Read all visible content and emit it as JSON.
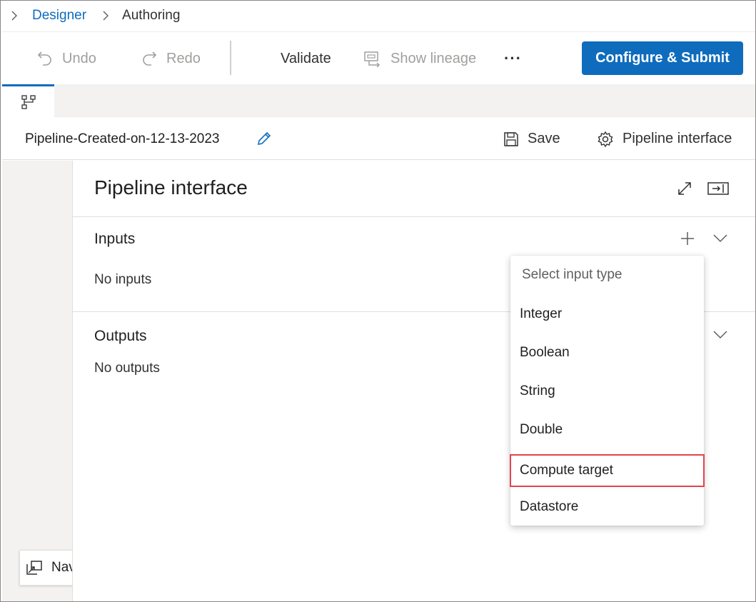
{
  "breadcrumb": {
    "items": [
      "Designer",
      "Authoring"
    ]
  },
  "toolbar": {
    "undo_label": "Undo",
    "redo_label": "Redo",
    "validate_label": "Validate",
    "show_lineage_label": "Show lineage",
    "more_label": "···",
    "configure_submit_label": "Configure & Submit"
  },
  "pipeline": {
    "name": "Pipeline-Created-on-12-13-2023",
    "save_label": "Save",
    "interface_label": "Pipeline interface"
  },
  "panel": {
    "title": "Pipeline interface",
    "inputs_title": "Inputs",
    "inputs_empty": "No inputs",
    "outputs_title": "Outputs",
    "outputs_empty": "No outputs"
  },
  "dropdown": {
    "header": "Select input type",
    "items": [
      "Integer",
      "Boolean",
      "String",
      "Double",
      "Compute target",
      "Datastore"
    ],
    "highlighted": "Compute target"
  },
  "navigator": {
    "label": "Navigator"
  },
  "colors": {
    "accent": "#0f6cbd",
    "highlight_border": "#e0454f"
  }
}
